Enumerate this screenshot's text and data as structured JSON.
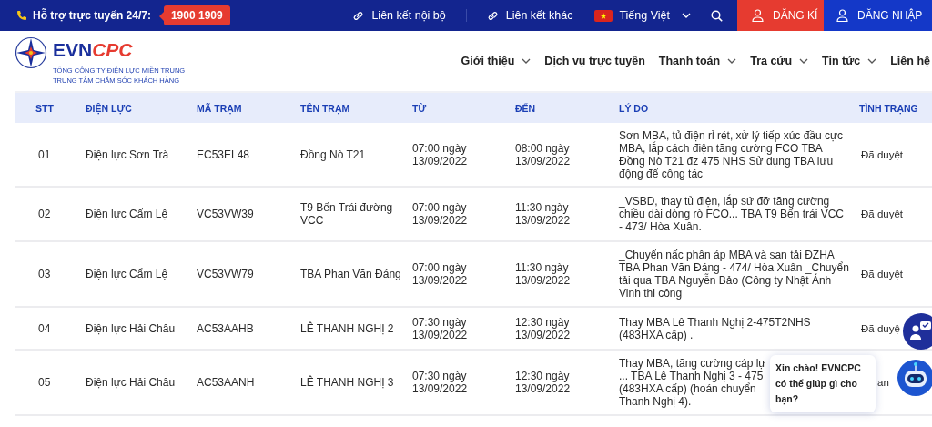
{
  "top_bar": {
    "hotline_label": "Hỗ trợ trực tuyến 24/7:",
    "hotline_number": "1900 1909",
    "links": [
      {
        "label": "Liên kết nội bộ"
      },
      {
        "label": "Liên kết khác"
      }
    ],
    "language": {
      "label": "Tiếng Việt"
    },
    "buttons": [
      {
        "label": "ĐĂNG KÍ",
        "kind": "register"
      },
      {
        "label": "ĐĂNG NHẬP",
        "kind": "login"
      }
    ]
  },
  "header": {
    "brand": {
      "part_1": "EVN",
      "part_2": "CPC"
    },
    "subtitle": [
      "TỔNG CÔNG TY ĐIỆN LỰC MIỀN TRUNG",
      "TRUNG TÂM CHĂM SÓC KHÁCH HÀNG"
    ],
    "nav": [
      {
        "label": "Giới thiệu",
        "has_dropdown": true
      },
      {
        "label": "Dịch vụ trực tuyến",
        "has_dropdown": false
      },
      {
        "label": "Thanh toán",
        "has_dropdown": true
      },
      {
        "label": "Tra cứu",
        "has_dropdown": true
      },
      {
        "label": "Tin tức",
        "has_dropdown": true
      },
      {
        "label": "Liên hệ",
        "has_dropdown": false
      }
    ]
  },
  "table": {
    "columns": [
      "STT",
      "ĐIỆN LỰC",
      "MÃ TRẠM",
      "TÊN TRẠM",
      "TỪ",
      "ĐẾN",
      "LÝ DO",
      "TÌNH TRẠNG"
    ],
    "rows": [
      {
        "cells": [
          "01",
          "Điện lực Sơn Trà",
          "EC53EL48",
          "Đồng Nò T21",
          "07:00 ngày 13/09/2022",
          "08:00 ngày 13/09/2022",
          "Sơn MBA, tủ điện rỉ rét, xử lý tiếp xúc đầu cực MBA, lắp cách điện tăng cường FCO TBA Đồng Nò T21 đz 475 NHS Sử dụng TBA lưu động để công tác",
          "Đã duyệt"
        ]
      },
      {
        "cells": [
          "02",
          "Điện lực Cẩm Lệ",
          "VC53VW39",
          "T9 Bến Trái đường VCC",
          "07:00 ngày 13/09/2022",
          "11:30 ngày 13/09/2022",
          "_VSBD, thay tủ điện, lắp sứ đỡ tăng cường chiều dài dòng rò FCO... TBA T9 Bến trái VCC - 473/ Hòa Xuân.",
          "Đã duyệt"
        ]
      },
      {
        "cells": [
          "03",
          "Điện lực Cẩm Lệ",
          "VC53VW79",
          "TBA Phan Văn Đáng",
          "07:00 ngày 13/09/2022",
          "11:30 ngày 13/09/2022",
          "_Chuyển nấc phân áp MBA và san tải ĐZHA TBA Phan Văn Đáng - 474/ Hòa Xuân _Chuyển tải qua TBA Nguyễn Bảo (Công ty Nhật Ánh Vinh thi công",
          "Đã duyệt"
        ]
      },
      {
        "cells": [
          "04",
          "Điện lực Hải Châu",
          "AC53AAHB",
          "LÊ THANH NGHỊ 2",
          "07:30 ngày 13/09/2022",
          "12:30 ngày 13/09/2022",
          "Thay MBA Lê Thanh Nghị 2-475T2NHS (483HXA cấp) .",
          "Đã duyệ"
        ]
      },
      {
        "cells": [
          "05",
          "Điện lực Hải Châu",
          "AC53AANH",
          "LÊ THANH NGHỊ 3",
          "07:30 ngày 13/09/2022",
          "12:30 ngày 13/09/2022",
          "Thay MBA, tăng cường cáp lự\n... TBA Lê Thanh Nghị 3 - 475\n(483HXA cấp) (hoán chuyển\nThanh Nghị 4).",
          "an"
        ]
      }
    ]
  },
  "chat": {
    "greeting": "Xin chào! EVNCPC có thể giúp gì cho bạn?"
  }
}
